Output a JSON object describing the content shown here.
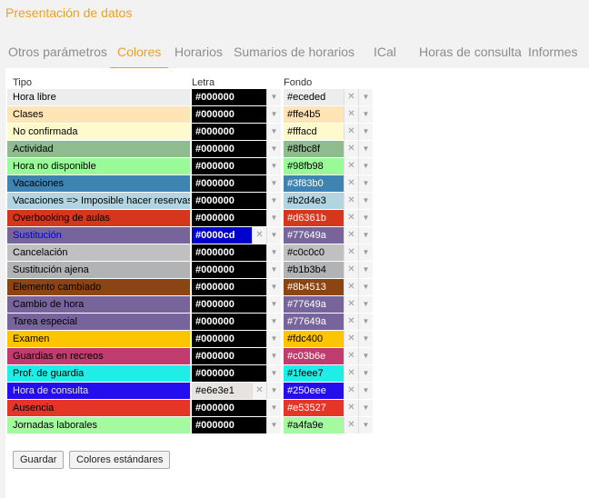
{
  "page_title": "Presentación de datos",
  "tabs": [
    {
      "label": "Otros parámetros",
      "active": false
    },
    {
      "label": "Colores",
      "active": true
    },
    {
      "label": "Horarios",
      "active": false
    },
    {
      "label": "Sumarios de horarios",
      "active": false
    },
    {
      "label": "ICal",
      "active": false
    },
    {
      "label": "Horas de consulta",
      "active": false
    },
    {
      "label": "Informes",
      "active": false
    }
  ],
  "columns": {
    "tipo": "Tipo",
    "letra": "Letra",
    "fondo": "Fondo"
  },
  "icons": {
    "clear": "close-icon",
    "dropdown": "chevron-down-icon"
  },
  "rows": [
    {
      "tipo": "Hora libre",
      "letra": "#000000",
      "fondo": "#eceded"
    },
    {
      "tipo": "Clases",
      "letra": "#000000",
      "fondo": "#ffe4b5"
    },
    {
      "tipo": "No confirmada",
      "letra": "#000000",
      "fondo": "#fffacd"
    },
    {
      "tipo": "Actividad",
      "letra": "#000000",
      "fondo": "#8fbc8f"
    },
    {
      "tipo": "Hora no disponible",
      "letra": "#000000",
      "fondo": "#98fb98"
    },
    {
      "tipo": "Vacaciones",
      "letra": "#000000",
      "fondo": "#3f83b0"
    },
    {
      "tipo": "Vacaciones => Imposible hacer reservas",
      "letra": "#000000",
      "fondo": "#b2d4e3"
    },
    {
      "tipo": "Overbooking de aulas",
      "letra": "#000000",
      "fondo": "#d6361b"
    },
    {
      "tipo": "Sustitución",
      "letra": "#0000cd",
      "fondo": "#77649a"
    },
    {
      "tipo": "Cancelación",
      "letra": "#000000",
      "fondo": "#c0c0c0"
    },
    {
      "tipo": "Sustitución ajena",
      "letra": "#000000",
      "fondo": "#b1b3b4"
    },
    {
      "tipo": "Elemento cambiado",
      "letra": "#000000",
      "fondo": "#8b4513"
    },
    {
      "tipo": "Cambio de hora",
      "letra": "#000000",
      "fondo": "#77649a"
    },
    {
      "tipo": "Tarea especial",
      "letra": "#000000",
      "fondo": "#77649a"
    },
    {
      "tipo": "Examen",
      "letra": "#000000",
      "fondo": "#fdc400"
    },
    {
      "tipo": "Guardias en recreos",
      "letra": "#000000",
      "fondo": "#c03b6e"
    },
    {
      "tipo": "Prof. de guardia",
      "letra": "#000000",
      "fondo": "#1feee7"
    },
    {
      "tipo": "Hora de consulta",
      "letra": "#e6e3e1",
      "fondo": "#250eee"
    },
    {
      "tipo": "Ausencia",
      "letra": "#000000",
      "fondo": "#e53527"
    },
    {
      "tipo": "Jornadas laborales",
      "letra": "#000000",
      "fondo": "#a4fa9e"
    }
  ],
  "buttons": {
    "save": "Guardar",
    "standard": "Colores estándares"
  }
}
